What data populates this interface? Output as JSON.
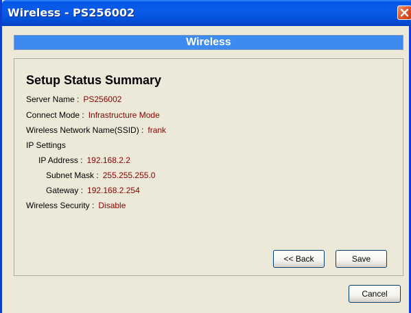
{
  "window": {
    "title": "Wireless - PS256002"
  },
  "header": {
    "title": "Wireless"
  },
  "summary": {
    "title": "Setup Status Summary",
    "server_name": {
      "label": "Server Name :",
      "value": "PS256002"
    },
    "connect_mode": {
      "label": "Connect Mode :",
      "value": "Infrastructure Mode"
    },
    "ssid": {
      "label": "Wireless Network Name(SSID) :",
      "value": "frank"
    },
    "ip_settings": {
      "label": "IP Settings"
    },
    "ip_address": {
      "label": "IP Address :",
      "value": "192.168.2.2"
    },
    "subnet_mask": {
      "label": "Subnet Mask :",
      "value": "255.255.255.0"
    },
    "gateway": {
      "label": "Gateway :",
      "value": "192.168.2.254"
    },
    "security": {
      "label": "Wireless Security :",
      "value": "Disable"
    }
  },
  "buttons": {
    "back": "<< Back",
    "save": "Save",
    "cancel": "Cancel"
  },
  "icons": {
    "close": "close-icon"
  },
  "colors": {
    "title_bar": "#0453DD",
    "header_band": "#3D8BF0",
    "value_text": "#8B0000",
    "close_button": "#E0552A"
  }
}
